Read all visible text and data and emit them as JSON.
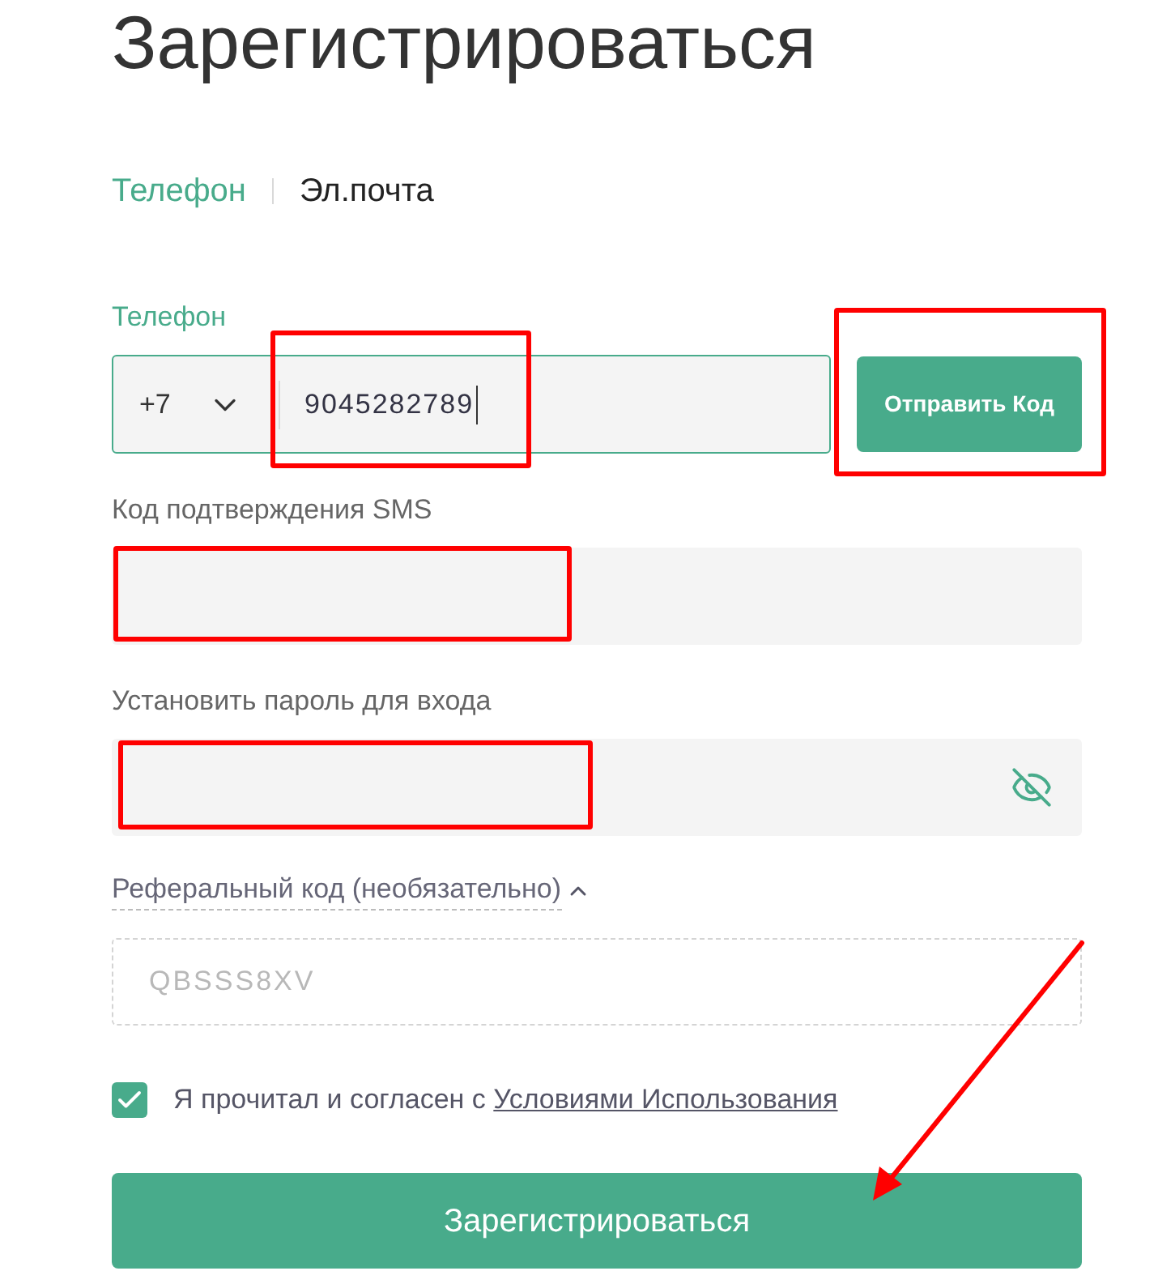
{
  "title": "Зарегистрироваться",
  "tabs": [
    {
      "label": "Телефон",
      "selected": true
    },
    {
      "label": "Эл.почта",
      "selected": false
    }
  ],
  "phone": {
    "label": "Телефон",
    "country_code": "+7",
    "value": "9045282789",
    "focused": true,
    "value_annotated": true,
    "send_button": {
      "label": "Отправить Код",
      "annotated": true
    }
  },
  "fields": [
    {
      "label": "Код подтверждения SMS",
      "kind": "code",
      "annotated": true
    },
    {
      "label": "Установить пароль для входа",
      "kind": "password",
      "annotated": true
    }
  ],
  "referral": {
    "label": "Реферальный код (необязательно)",
    "expanded": true,
    "placeholder": "QBSSS8XV"
  },
  "agreement": {
    "checked": true,
    "text": "Я прочитал и согласен с",
    "link": "Условиями Использования"
  },
  "submit_button": {
    "label": "Зарегистрироваться",
    "arrow": true
  }
}
